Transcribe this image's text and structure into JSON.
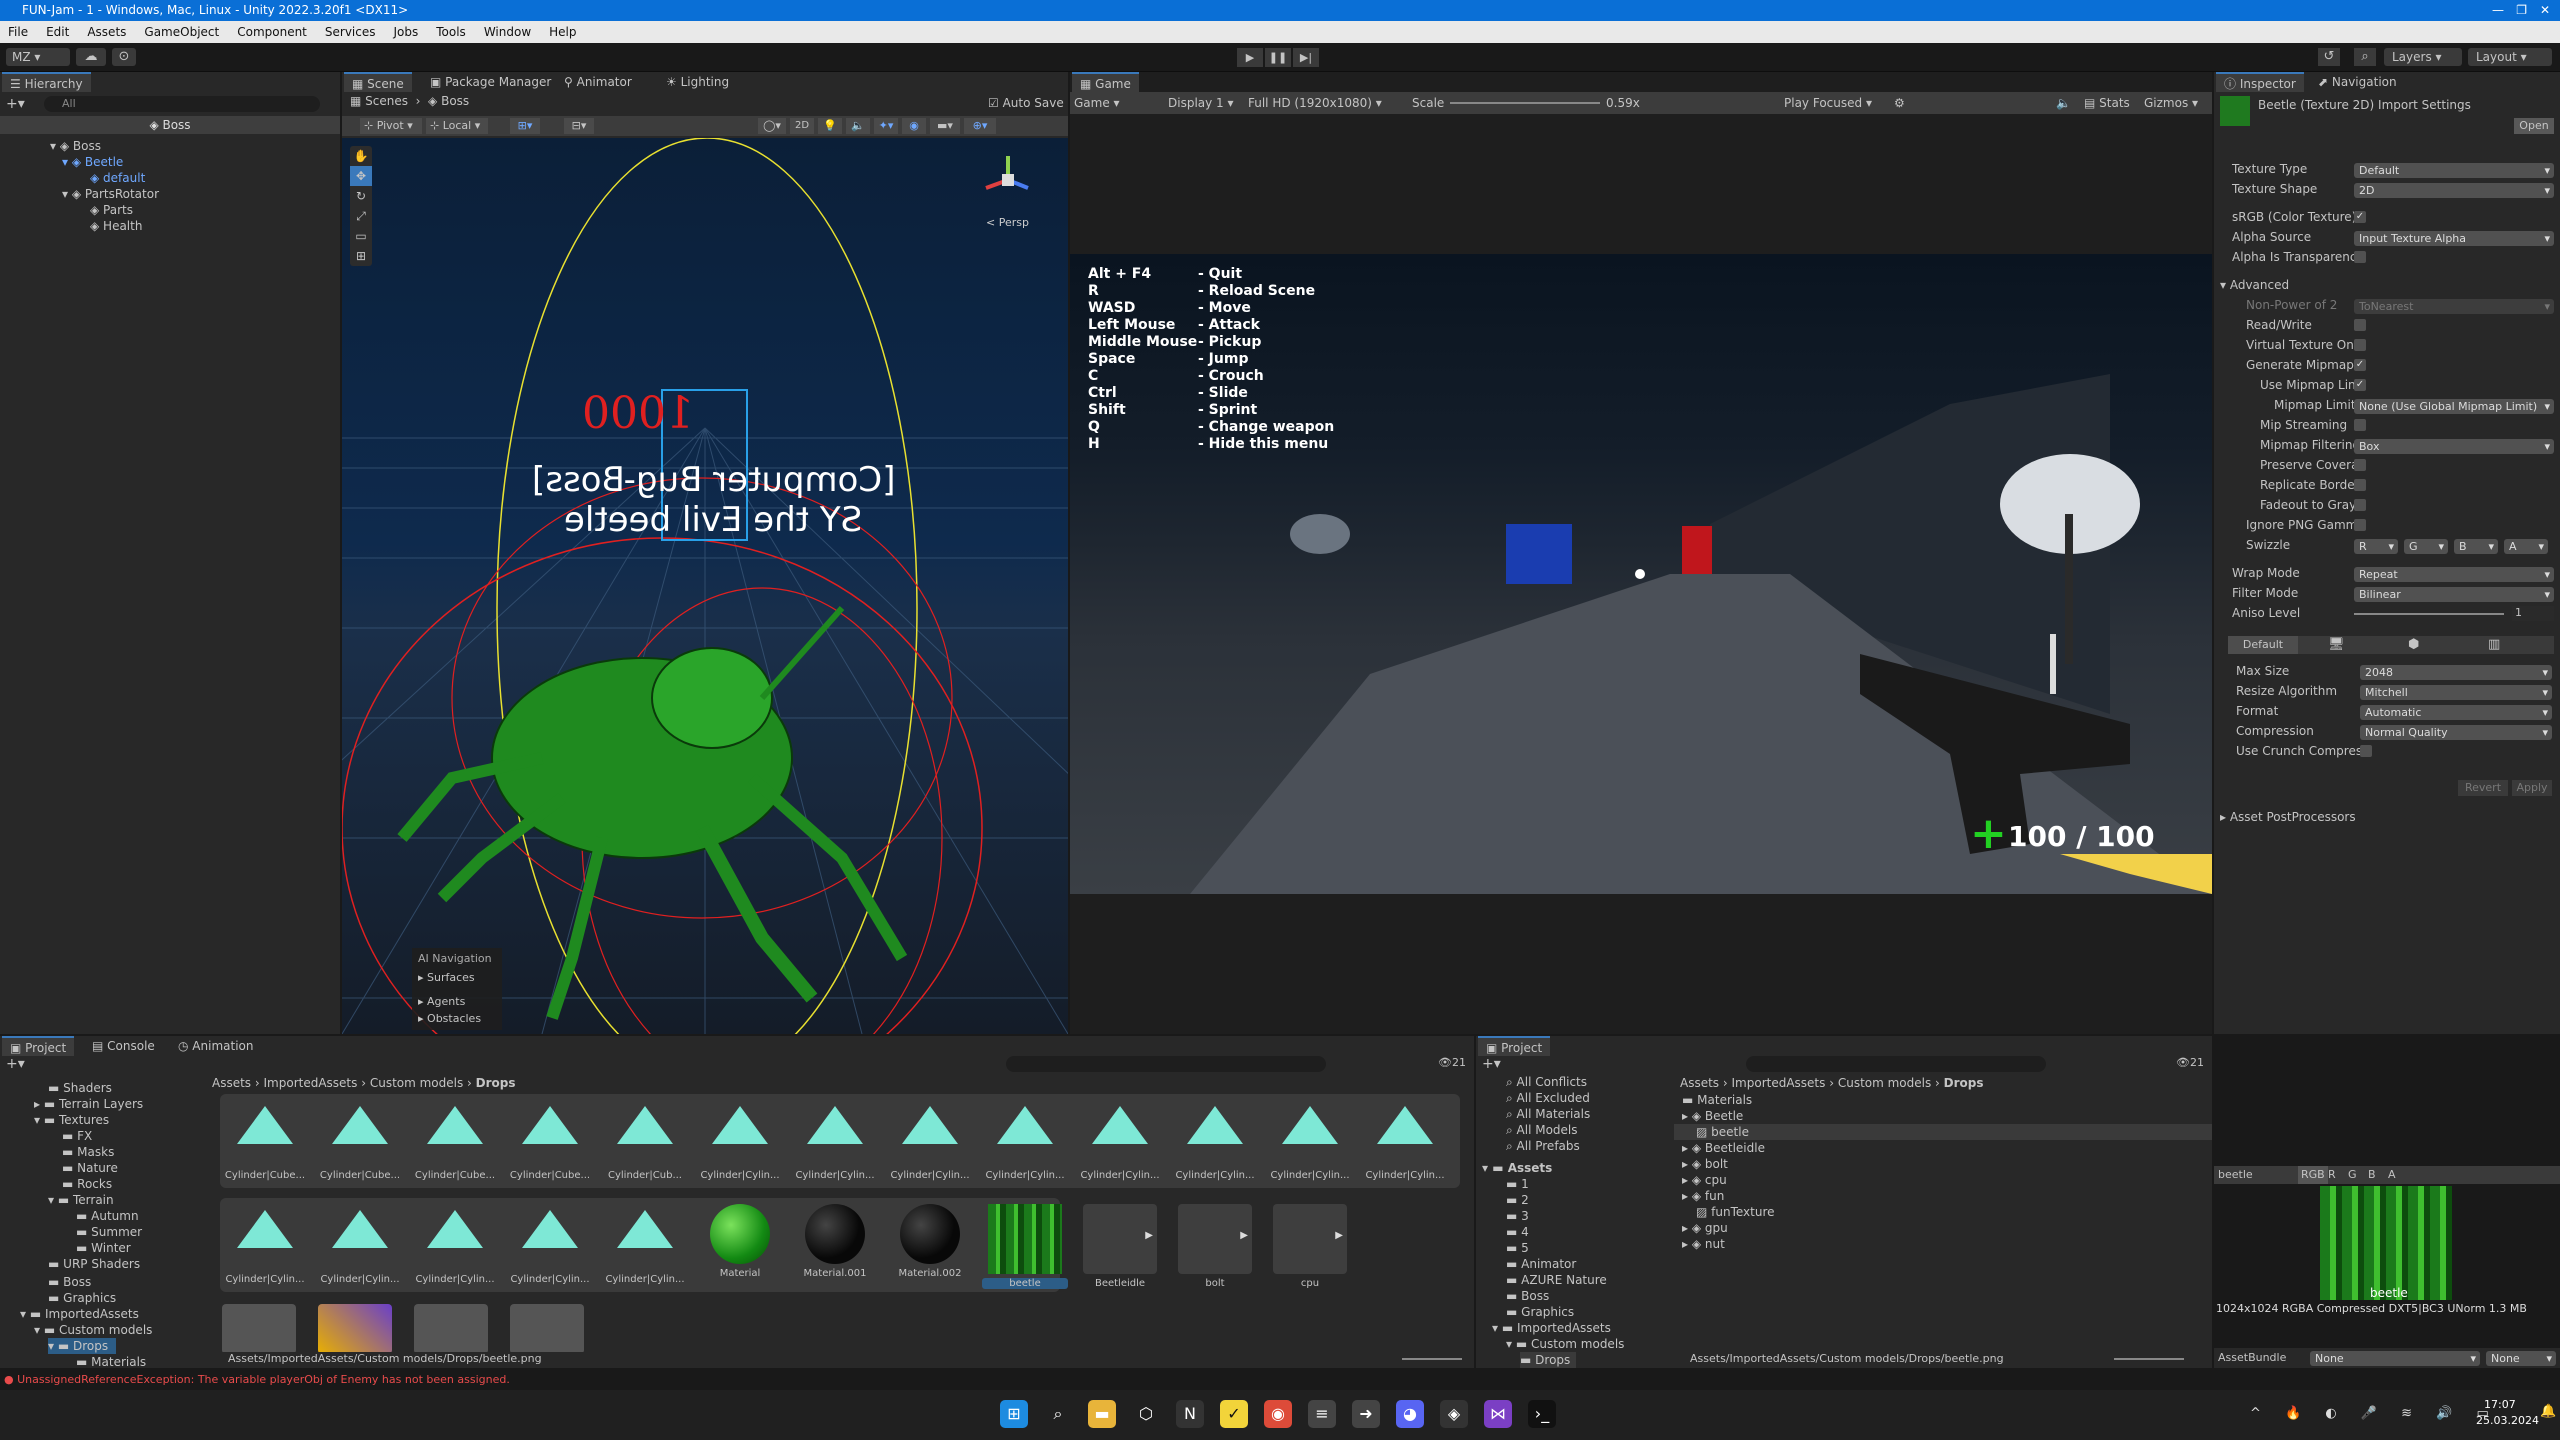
{
  "window": {
    "title": "FUN-Jam - 1 - Windows, Mac, Linux - Unity 2022.3.20f1 <DX11>"
  },
  "menu": [
    "File",
    "Edit",
    "Assets",
    "GameObject",
    "Component",
    "Services",
    "Jobs",
    "Tools",
    "Window",
    "Help"
  ],
  "toolbar": {
    "account": "MZ",
    "layers": "Layers",
    "layout": "Layout"
  },
  "hierarchy": {
    "tab": "Hierarchy",
    "search": "All",
    "scene": "Boss",
    "items": [
      "Boss",
      "Beetle",
      "default",
      "PartsRotator",
      "Parts",
      "Health"
    ]
  },
  "scene": {
    "tabs": [
      "Scene",
      "Package Manager",
      "Animator",
      "Lighting"
    ],
    "crumb_scenes": "Scenes",
    "crumb_boss": "Boss",
    "autosave": "Auto Save",
    "pivot": "Pivot",
    "local": "Local",
    "mode2d": "2D",
    "persp": "< Persp",
    "hp": "1000",
    "name1": "[Computer Bug-Boss]",
    "name2": "SY the Evil beetle",
    "nav": {
      "title": "AI Navigation",
      "items": [
        "Surfaces",
        "Agents",
        "Obstacles"
      ]
    }
  },
  "game": {
    "tab": "Game",
    "mode": "Game",
    "display": "Display 1",
    "res": "Full HD (1920x1080)",
    "scale_lbl": "Scale",
    "scale_val": "0.59x",
    "play": "Play Focused",
    "stats": "Stats",
    "gizmos": "Gizmos",
    "keys": "Alt + F4\nR\nWASD\nLeft Mouse\nMiddle Mouse\nSpace\nC\nCtrl\nShift\nQ\nH",
    "actions": "- Quit\n- Reload Scene\n- Move\n- Attack\n- Pickup\n- Jump\n- Crouch\n- Slide\n- Sprint\n- Change weapon\n- Hide this menu",
    "health": "100 / 100",
    "plus": "+"
  },
  "inspector": {
    "tabs": [
      "Inspector",
      "Navigation"
    ],
    "title": "Beetle (Texture 2D) Import Settings",
    "open": "Open",
    "fields": [
      [
        "Texture Type",
        "Default"
      ],
      [
        "Texture Shape",
        "2D"
      ]
    ],
    "srgb": "sRGB (Color Texture)",
    "alpha_src": "Alpha Source",
    "alpha_src_val": "Input Texture Alpha",
    "alpha_trans": "Alpha Is Transparenc",
    "advanced": "Advanced",
    "npot": "Non-Power of 2",
    "npot_val": "ToNearest",
    "rw": "Read/Write",
    "vt": "Virtual Texture Onl",
    "genmip": "Generate Mipmaps",
    "usemip": "Use Mipmap Lin",
    "miplimit": "Mipmap Limit",
    "miplimit_val": "None (Use Global Mipmap Limit)",
    "mipstream": "Mip Streaming",
    "mipfilter": "Mipmap Filtering",
    "mipfilter_val": "Box",
    "preserve": "Preserve Covera",
    "replicate": "Replicate Borde",
    "fadeout": "Fadeout to Gray",
    "ignorepng": "Ignore PNG Gamm",
    "swizzle": "Swizzle",
    "sw": [
      "R",
      "G",
      "B",
      "A"
    ],
    "wrap": "Wrap Mode",
    "wrap_val": "Repeat",
    "filter": "Filter Mode",
    "filter_val": "Bilinear",
    "aniso": "Aniso Level",
    "aniso_val": "1",
    "platform": "Default",
    "maxsize": "Max Size",
    "maxsize_val": "2048",
    "resize": "Resize Algorithm",
    "resize_val": "Mitchell",
    "format": "Format",
    "format_val": "Automatic",
    "compression": "Compression",
    "compression_val": "Normal Quality",
    "crunch": "Use Crunch Compres",
    "revert": "Revert",
    "apply": "Apply",
    "postproc": "Asset PostProcessors",
    "preview_name": "beetle",
    "channels": [
      "RGB",
      "R",
      "G",
      "B",
      "A"
    ],
    "preview_label": "beetle",
    "info": "1024x1024  RGBA Compressed DXT5|BC3 UNorm  1.3 MB",
    "bundle": "AssetBundle",
    "bundle_val": "None",
    "bundle_var": "None"
  },
  "project": {
    "tabs": [
      "Project",
      "Console",
      "Animation"
    ],
    "crumb": [
      "Assets",
      "ImportedAssets",
      "Custom models",
      "Drops"
    ],
    "count": "21",
    "tree": [
      "Shaders",
      "Terrain Layers",
      "Textures",
      "FX",
      "Masks",
      "Nature",
      "Rocks",
      "Terrain",
      "Autumn",
      "Summer",
      "Winter",
      "URP Shaders",
      "Boss",
      "Graphics",
      "ImportedAssets",
      "Custom models",
      "Drops",
      "Materials"
    ],
    "row1": [
      "Cylinder|Cube...",
      "Cylinder|Cube...",
      "Cylinder|Cube...",
      "Cylinder|Cube...",
      "Cylinder|Cub...",
      "Cylinder|Cylin...",
      "Cylinder|Cylin...",
      "Cylinder|Cylin...",
      "Cylinder|Cylin...",
      "Cylinder|Cylin...",
      "Cylinder|Cylin...",
      "Cylinder|Cylin...",
      "Cylinder|Cylin..."
    ],
    "row2": [
      "Cylinder|Cylin...",
      "Cylinder|Cylin...",
      "Cylinder|Cylin...",
      "Cylinder|Cylin...",
      "Cylinder|Cylin...",
      "Material",
      "Material.001",
      "Material.002",
      "beetle",
      "Beetleidle",
      "bolt",
      "cpu"
    ],
    "path": "Assets/ImportedAssets/Custom models/Drops/beetle.png"
  },
  "project2": {
    "tab": "Project",
    "count": "21",
    "fav": [
      "All Conflicts",
      "All Excluded",
      "All Materials",
      "All Models",
      "All Prefabs"
    ],
    "assets": "Assets",
    "tree": [
      "1",
      "2",
      "3",
      "4",
      "5",
      "Animator",
      "AZURE Nature",
      "Boss",
      "Graphics",
      "ImportedAssets",
      "Custom models",
      "Drops"
    ],
    "crumb": [
      "Assets",
      "ImportedAssets",
      "Custom models",
      "Drops"
    ],
    "list": [
      "Materials",
      "Beetle",
      "beetle",
      "Beetleidle",
      "bolt",
      "cpu",
      "fun",
      "funTexture",
      "gpu",
      "nut"
    ],
    "path": "Assets/ImportedAssets/Custom models/Drops/beetle.png"
  },
  "status": {
    "error": "UnassignedReferenceException: The variable playerObj of Enemy has not been assigned."
  },
  "taskbar": {
    "time": "17:07",
    "date": "25.03.2024"
  },
  "colors": {
    "accent": "#3a79bb",
    "titlebar": "#0a6fd6",
    "teal": "#7ee8d6",
    "health": "#22d122",
    "error": "#e84b4b"
  }
}
